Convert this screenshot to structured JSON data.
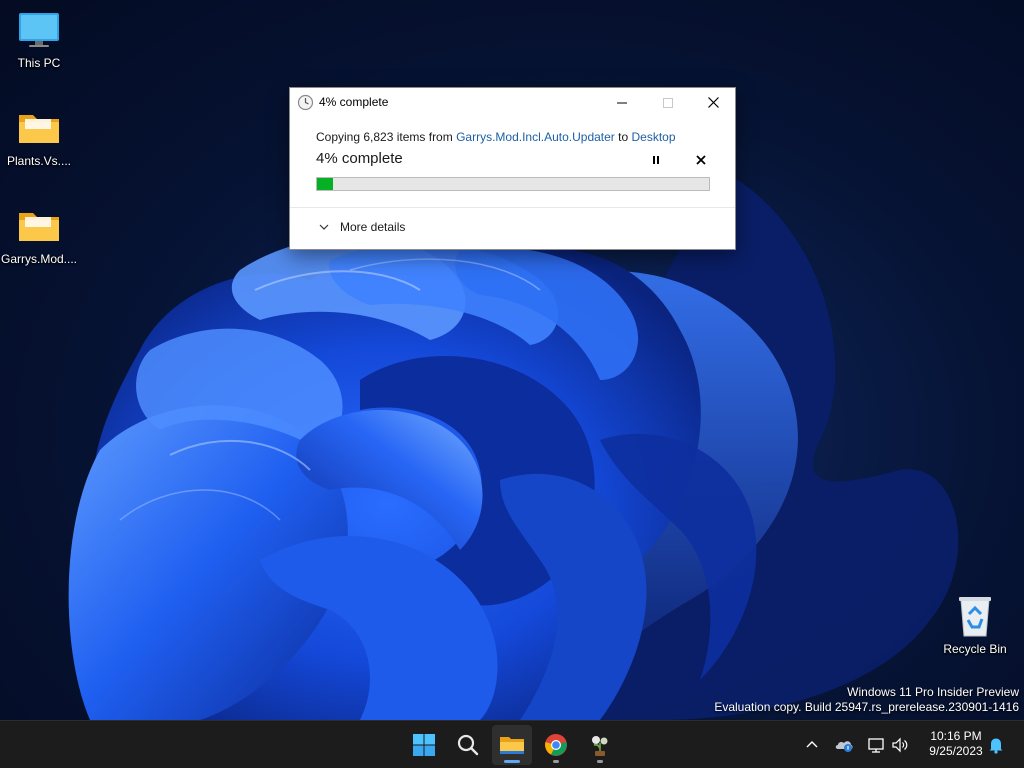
{
  "desktop": {
    "icons": [
      {
        "label": "This PC",
        "icon": "monitor-icon"
      },
      {
        "label": "Plants.Vs....",
        "icon": "folder-icon"
      },
      {
        "label": "Garrys.Mod....",
        "icon": "folder-icon"
      },
      {
        "label": "Recycle Bin",
        "icon": "recycle-bin-icon"
      }
    ]
  },
  "dialog": {
    "title": "4% complete",
    "copy_prefix": "Copying 6,823 items from ",
    "source": "Garrys.Mod.Incl.Auto.Updater",
    "to_word": " to ",
    "destination": "Desktop",
    "progress_label": "4% complete",
    "progress_fraction": 0.04,
    "more_details": "More details",
    "accent_color": "#06b025",
    "link_color": "#1e5fa8"
  },
  "watermark": {
    "line1": "Windows 11 Pro Insider Preview",
    "line2": "Evaluation copy. Build 25947.rs_prerelease.230901-1416"
  },
  "taskbar": {
    "apps": [
      "start-icon",
      "search-icon",
      "file-explorer-icon",
      "chrome-icon",
      "app-icon"
    ],
    "tray": [
      "chevron-up-icon",
      "onedrive-icon",
      "network-icon",
      "volume-icon",
      "bell-icon"
    ],
    "time": "10:16 PM",
    "date": "9/25/2023"
  }
}
